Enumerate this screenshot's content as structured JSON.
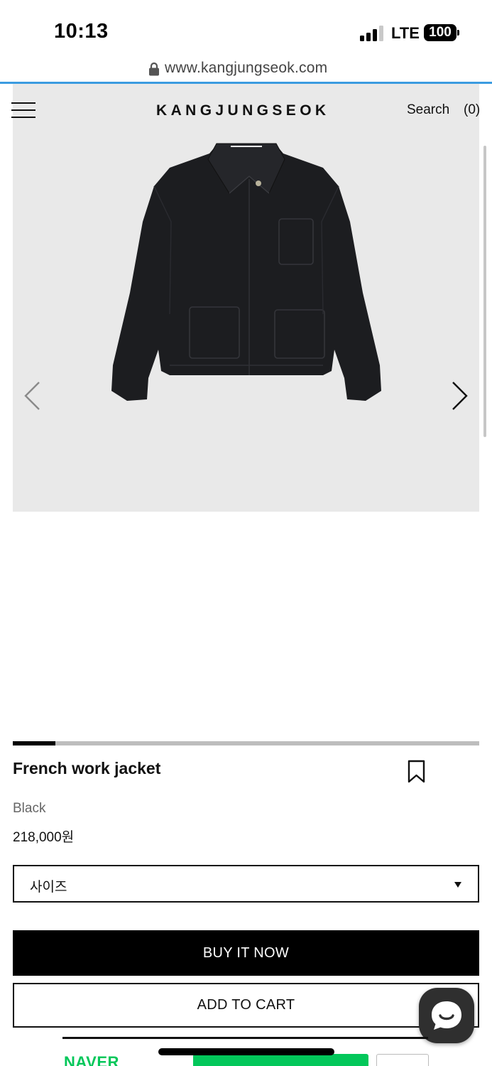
{
  "status_bar": {
    "time": "10:13",
    "carrier": "LTE",
    "battery": "100",
    "signal_bars_active": 3,
    "signal_bars_total": 4
  },
  "browser": {
    "url": "www.kangjungseok.com",
    "accent_color": "#3b9be0"
  },
  "header": {
    "menu_icon": "hamburger-menu-icon",
    "brand": "KANGJUNGSEOK",
    "search_label": "Search",
    "cart_count": "(0)"
  },
  "gallery": {
    "background": "#e9e9e9",
    "image": "black-work-jacket",
    "prev_icon": "chevron-left-icon",
    "next_icon": "chevron-right-icon",
    "progress_fraction": 0.091
  },
  "product": {
    "name": "French work jacket",
    "color": "Black",
    "price": "218,000원",
    "bookmark_icon": "bookmark-icon"
  },
  "options": {
    "size_label": "사이즈"
  },
  "actions": {
    "buy_now": "BUY IT NOW",
    "add_to_cart": "ADD TO CART"
  },
  "chat": {
    "icon": "chat-bubble-icon"
  },
  "naver_pay": {
    "logo": "NAVER",
    "brand_color": "#03c75a"
  }
}
